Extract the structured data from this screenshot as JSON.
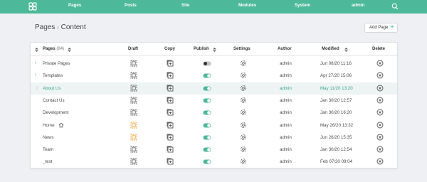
{
  "nav": {
    "items": [
      "Pages",
      "Posts",
      "Site",
      "Modules",
      "System",
      "admin"
    ],
    "accent": "#4db89a"
  },
  "header": {
    "breadcrumb_root": "Pages",
    "separator": "›",
    "breadcrumb_current": "Content",
    "add_label": "Add Page",
    "add_icon": "+"
  },
  "table": {
    "columns": {
      "pages": "Pages",
      "count": "(84)",
      "draft": "Draft",
      "copy": "Copy",
      "publish": "Publish",
      "settings": "Settings",
      "author": "Author",
      "modified": "Modified",
      "delete": "Delete"
    },
    "rows": [
      {
        "name": "Private Pages",
        "expandable": true,
        "draft": "normal",
        "published": false,
        "author": "admin",
        "modified": "Jun 08/20 11:16"
      },
      {
        "name": "Templates",
        "expandable": true,
        "draft": "normal",
        "published": true,
        "author": "admin",
        "modified": "Apr 27/20 15:06"
      },
      {
        "name": "About Us",
        "expandable": false,
        "draft": "normal",
        "published": true,
        "author": "admin",
        "modified": "May 11/20 13:20",
        "highlighted": true
      },
      {
        "name": "Contact Us",
        "expandable": false,
        "draft": "normal",
        "published": true,
        "author": "admin",
        "modified": "Jan 30/20 12:57"
      },
      {
        "name": "Development",
        "expandable": false,
        "draft": "normal",
        "published": true,
        "author": "admin",
        "modified": "Jan 30/20 16:20"
      },
      {
        "name": "Home",
        "expandable": false,
        "home": true,
        "draft": "orange",
        "published": true,
        "author": "admin",
        "modified": "May 26/20 13:32"
      },
      {
        "name": "News",
        "expandable": false,
        "draft": "orange",
        "published": true,
        "author": "admin",
        "modified": "Jun 26/20 15:35"
      },
      {
        "name": "Team",
        "expandable": false,
        "draft": "normal",
        "published": true,
        "author": "admin",
        "modified": "Jan 30/20 12:54"
      },
      {
        "name": "_test",
        "expandable": false,
        "draft": "normal",
        "published": true,
        "author": "admin",
        "modified": "Feb 07/20 09:04"
      }
    ]
  }
}
